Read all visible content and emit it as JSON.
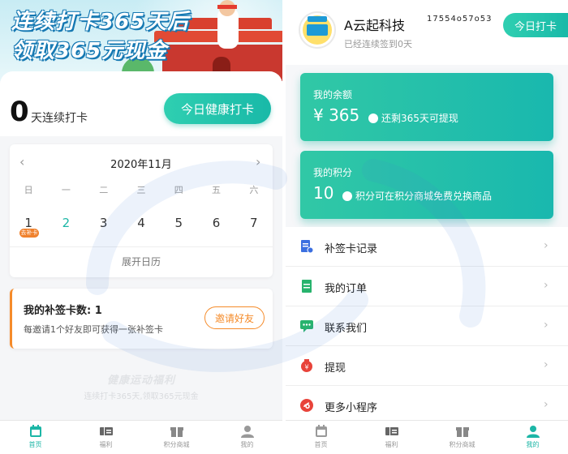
{
  "left": {
    "banner": {
      "line1": "连续打卡365天后",
      "line2": "领取365元现金"
    },
    "streak": {
      "count": "0",
      "label": "天连续打卡"
    },
    "checkin_button": "今日健康打卡",
    "calendar": {
      "prev": "‹",
      "next": "›",
      "month": "2020年11月",
      "weekdays": [
        "日",
        "一",
        "二",
        "三",
        "四",
        "五",
        "六"
      ],
      "days": [
        "1",
        "2",
        "3",
        "4",
        "5",
        "6",
        "7"
      ],
      "today_index": 1,
      "makeup_tag": "去补卡",
      "expand": "展开日历"
    },
    "makeup": {
      "title": "我的补签卡数: 1",
      "desc": "每邀请1个好友即可获得一张补签卡",
      "invite_button": "邀请好友"
    },
    "promo": {
      "title": "健康运动福利",
      "sub": "连续打卡365天,领取365元现金"
    },
    "tabs": [
      {
        "label": "首页",
        "icon": "calendar-icon",
        "active": true
      },
      {
        "label": "福利",
        "icon": "ticket-icon",
        "active": false
      },
      {
        "label": "积分商城",
        "icon": "gift-icon",
        "active": false
      },
      {
        "label": "我的",
        "icon": "user-icon",
        "active": false
      }
    ]
  },
  "right": {
    "profile": {
      "name": "A云起科技",
      "id": "17554o57o53",
      "signed": "已经连续签到0天",
      "checkin_button": "今日打卡"
    },
    "balance": {
      "label": "我的余额",
      "value": "¥ 365",
      "note": "还剩365天可提现"
    },
    "points": {
      "label": "我的积分",
      "value": "10",
      "note": "积分可在积分商城免费兑换商品"
    },
    "menu": [
      {
        "label": "补签卡记录",
        "icon": "document-check-icon",
        "color": "#3b6fe0"
      },
      {
        "label": "我的订单",
        "icon": "order-icon",
        "color": "#27b36d"
      },
      {
        "label": "联系我们",
        "icon": "chat-icon",
        "color": "#27b36d"
      },
      {
        "label": "提现",
        "icon": "money-bag-icon",
        "color": "#e8433a"
      },
      {
        "label": "更多小程序",
        "icon": "mini-program-icon",
        "color": "#e8433a"
      }
    ],
    "tabs": [
      {
        "label": "首页",
        "icon": "calendar-icon",
        "active": false
      },
      {
        "label": "福利",
        "icon": "ticket-icon",
        "active": false
      },
      {
        "label": "积分商城",
        "icon": "gift-icon",
        "active": false
      },
      {
        "label": "我的",
        "icon": "user-icon",
        "active": true
      }
    ]
  },
  "colors": {
    "accent": "#1cb6a6",
    "orange": "#f58b2a"
  }
}
